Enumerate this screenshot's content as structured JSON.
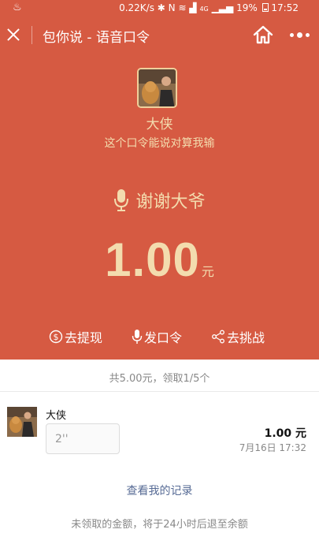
{
  "status_bar": {
    "net_speed": "0.22K/s",
    "nfc": "N",
    "signal_type": "4G",
    "battery": "19%",
    "time": "17:52",
    "left_icon": "gesture-icon"
  },
  "nav": {
    "title": "包你说 - 语音口令"
  },
  "packet": {
    "sender_name": "大侠",
    "slogan": "这个口令能说对算我输",
    "voice_phrase": "谢谢大爷",
    "amount": "1.00",
    "unit": "元"
  },
  "actions": [
    {
      "label": "去提现",
      "icon": "dollar-circle-icon"
    },
    {
      "label": "发口令",
      "icon": "microphone-icon"
    },
    {
      "label": "去挑战",
      "icon": "share-icon"
    }
  ],
  "summary": "共5.00元，领取1/5个",
  "record": {
    "name": "大侠",
    "voice_duration": "2''",
    "amount": "1.00 元",
    "time": "7月16日 17:32"
  },
  "links": {
    "my_records": "查看我的记录"
  },
  "note": "未领取的金额，将于24小时后退至余额",
  "colors": {
    "hero_bg": "#d65a42",
    "gold_text": "#f3dcae",
    "link": "#576b95"
  }
}
